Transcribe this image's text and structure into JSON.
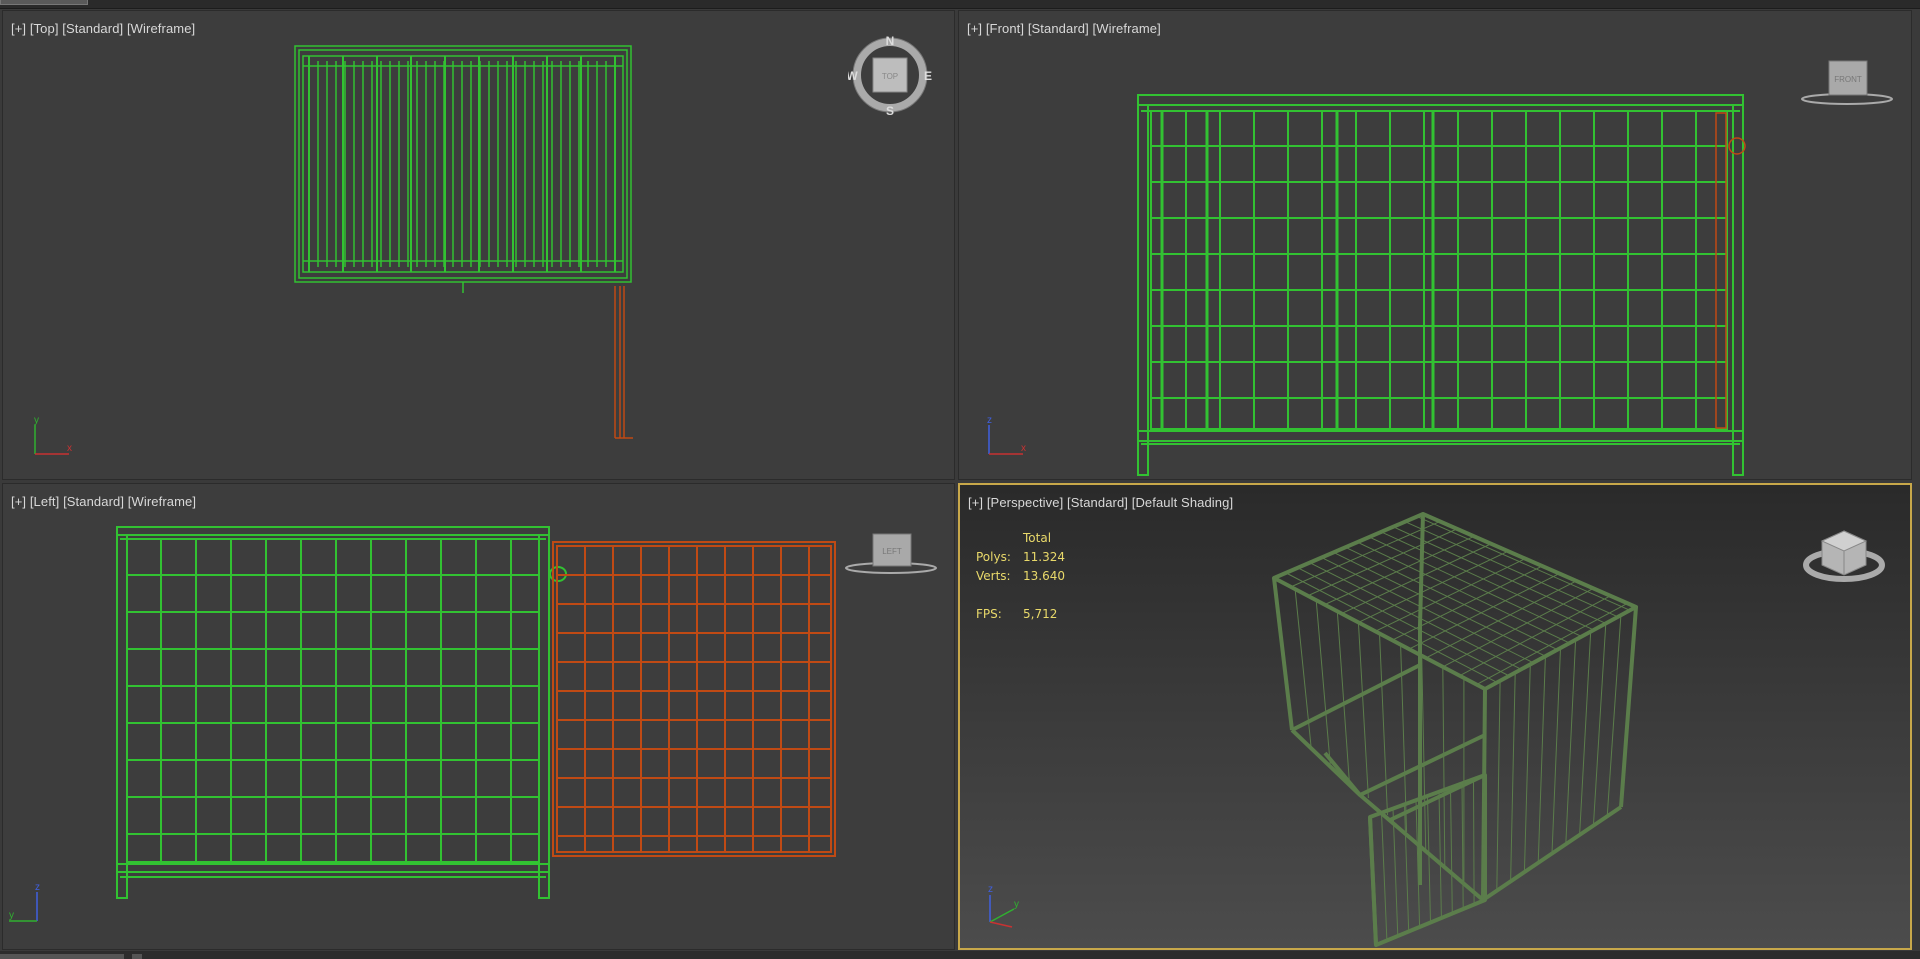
{
  "viewports": {
    "top": {
      "labels": [
        "[+]",
        "[Top]",
        "[Standard]",
        "[Wireframe]"
      ],
      "cube_text": "TOP",
      "compass": {
        "n": "N",
        "s": "S",
        "e": "E",
        "w": "W"
      },
      "axes": {
        "up": "y",
        "right": "x"
      }
    },
    "front": {
      "labels": [
        "[+]",
        "[Front]",
        "[Standard]",
        "[Wireframe]"
      ],
      "cube_text": "FRONT",
      "axes": {
        "up": "z",
        "right": "x"
      }
    },
    "left": {
      "labels": [
        "[+]",
        "[Left]",
        "[Standard]",
        "[Wireframe]"
      ],
      "cube_text": "LEFT",
      "axes": {
        "up": "z",
        "right": "y"
      }
    },
    "persp": {
      "labels": [
        "[+]",
        "[Perspective]",
        "[Standard]",
        "[Default Shading]"
      ],
      "axes": {
        "up": "z",
        "right": "y"
      },
      "stats": {
        "header": "Total",
        "polys_label": "Polys:",
        "polys": "11.324",
        "verts_label": "Verts:",
        "verts": "13.640",
        "fps_label": "FPS:",
        "fps": "5,712"
      }
    }
  },
  "colors": {
    "wire_green": "#32c232",
    "wire_orange": "#c04a14",
    "shaded_green": "#5b7d4b",
    "stats_yellow": "#e9d96a",
    "active_border": "#c8a84a",
    "axis_x": "#c83232",
    "axis_y": "#30b030",
    "axis_z": "#4060e0"
  }
}
